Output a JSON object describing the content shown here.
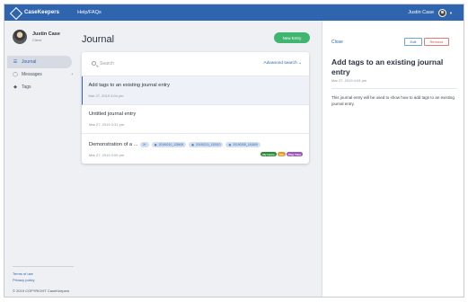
{
  "header": {
    "app_name": "CaseKeepers",
    "help_link": "Help/FAQs",
    "user_name": "Justin Case"
  },
  "sidebar": {
    "profile": {
      "name": "Justin Case",
      "role": "Client"
    },
    "items": [
      {
        "label": "Journal",
        "icon": "journal-icon",
        "active": true
      },
      {
        "label": "Messages",
        "icon": "chat-bubble-icon",
        "has_chevron": true
      },
      {
        "label": "Tags",
        "icon": "tag-icon"
      }
    ],
    "footer": {
      "terms": "Terms of use",
      "privacy": "Privacy policy",
      "copyright": "© 2019 COPYRIGHT CaseKeepers"
    }
  },
  "main": {
    "title": "Journal",
    "new_entry_label": "New Entry",
    "search": {
      "placeholder": "Search",
      "advanced_label": "Advanced search"
    },
    "entries": [
      {
        "title": "Add tags to an existing journal entry",
        "date": "Mar 27, 2019 4:04 pm",
        "selected": true
      },
      {
        "title": "Untitled journal entry",
        "date": "Mar 27, 2019 3:31 pm"
      },
      {
        "title": "Demonstration of a ...",
        "date": "Mar 27, 2019 3:09 pm",
        "attachments_count": "3+",
        "attachments": [
          "20190210_125409",
          "20190210_130010",
          "20190208_181809"
        ],
        "tags": [
          {
            "label": "My Home",
            "color": "#2e8b3a"
          },
          {
            "label": "Ida",
            "color": "#e09a2a"
          },
          {
            "label": "Play Time",
            "color": "#9b59b6"
          }
        ]
      }
    ]
  },
  "detail": {
    "close_label": "Close",
    "edit_label": "Edit",
    "remove_label": "Remove",
    "title": "Add tags to an existing journal entry",
    "date": "Mar 27, 2019 4:04 pm",
    "body": "This journal entry will be used to show how to add tags to an existing journal entry."
  },
  "colors": {
    "brand": "#2f64ae",
    "primary_action": "#3fb56f",
    "danger": "#d24b4b"
  }
}
